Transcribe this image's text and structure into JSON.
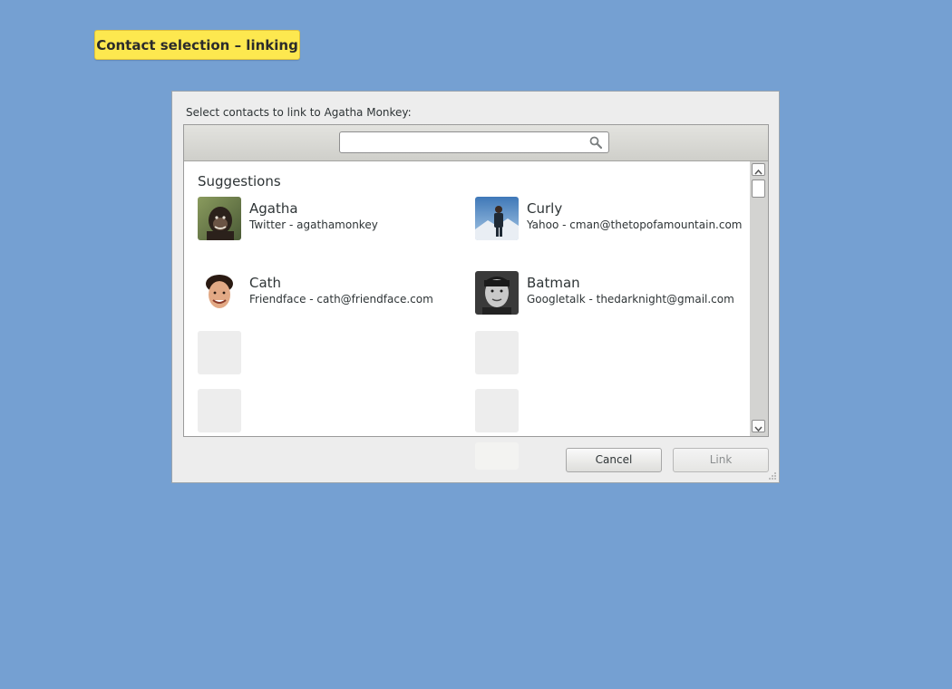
{
  "label": {
    "text": "Contact selection – linking"
  },
  "dialog": {
    "prompt": "Select contacts to link to Agatha Monkey:",
    "search": {
      "value": "",
      "placeholder": ""
    },
    "section_title": "Suggestions",
    "contacts": [
      {
        "name": "Agatha",
        "detail": "Twitter - agathamonkey",
        "avatar": "chimpanzee-photo"
      },
      {
        "name": "Curly",
        "detail": "Yahoo - cman@thetopofamountain.com",
        "avatar": "mountain-climber-photo"
      },
      {
        "name": "Cath",
        "detail": "Friendface - cath@friendface.com",
        "avatar": "smiling-person-photo"
      },
      {
        "name": "Batman",
        "detail": "Googletalk - thedarknight@gmail.com",
        "avatar": "man-portrait-photo"
      }
    ],
    "buttons": {
      "cancel": "Cancel",
      "link": "Link"
    }
  },
  "colors": {
    "background": "#75a0d2",
    "label_background": "#fde84f",
    "dialog_background": "#ededed"
  }
}
